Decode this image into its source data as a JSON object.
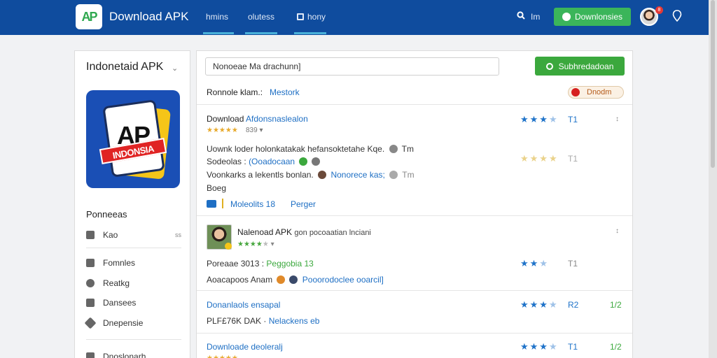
{
  "header": {
    "logo_text": "AP",
    "brand": "Download APK",
    "nav": [
      "hmins",
      "olutess",
      "hony"
    ],
    "search_label": "Im",
    "download_button": "Downlonsies",
    "notification_count": "8",
    "colors": {
      "bar": "#0f4c9e",
      "accent": "#3bb55a"
    }
  },
  "sidebar": {
    "title": "Indonetaid APK",
    "app_icon": {
      "ap": "AP",
      "ribbon": "INDONSIA"
    },
    "section_label": "Ponneeas",
    "items": [
      {
        "label": "Kao",
        "count": "ss",
        "icon": "home-icon"
      },
      {
        "label": "Fomnles",
        "icon": "folder-icon"
      },
      {
        "label": "Reatkg",
        "icon": "gear-icon"
      },
      {
        "label": "Dansees",
        "icon": "grid-icon"
      },
      {
        "label": "Dnepensie",
        "icon": "tool-icon"
      },
      {
        "label": "Dnoslonarh",
        "icon": "download-icon"
      }
    ]
  },
  "main": {
    "search_value": "Nonoeae Ma drachunn]",
    "submit_button": "Subhredadoan",
    "filter_label": "Ronnole klam.:",
    "filter_link": "Mestork",
    "filter_badge": "Dnodm",
    "entries": [
      {
        "title": "Download",
        "title_link": "Afdonsnaslealon",
        "sub_rating": "839",
        "rating": "1",
        "line1": "Uownk loder holonkatakak hefansoktetahe Kqe.",
        "line1_tail": "Tm",
        "line2": "Sodeolas :",
        "line2_link": "(Ooadocaan",
        "line3": "Voonkarks a lekentls bonlan.",
        "line3_link": "Nonorece kas;",
        "line3_tail": "Tm",
        "line4": "Boeg",
        "rating2": "1",
        "tag1": "Moleolits 18",
        "tag2": "Perger"
      },
      {
        "title": "Nalenoad APK",
        "subtitle": "gon pocoaatian lnciani",
        "rating": "1",
        "line1": "Poreaae 3013 :",
        "line1_green": "Peggobia 13",
        "line2": "Aoacapoos Anam",
        "line2_link": "Pooorodoclee ooarcil]"
      },
      {
        "title": "Donanlaols ensapal",
        "rating": "2",
        "side": "1/2",
        "line1": "PLF£76K DAK",
        "line1_link": "Nelackens eb"
      },
      {
        "title": "Downloade deoleralj",
        "rating": "1",
        "side": "1/2"
      }
    ]
  }
}
